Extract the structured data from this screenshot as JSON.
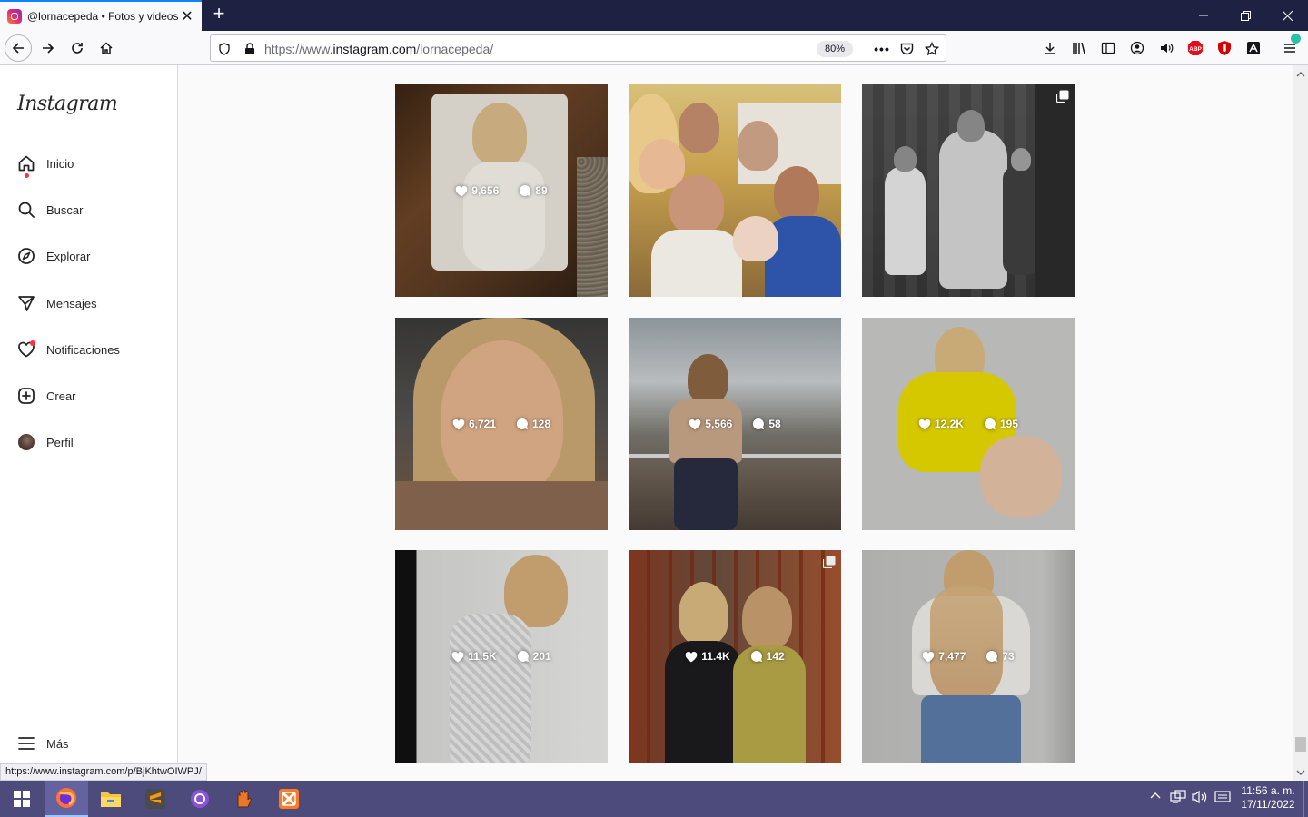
{
  "browser": {
    "tab_title": "@lornacepeda • Fotos y videos",
    "url_prefix": "https://www.",
    "url_domain": "instagram.com",
    "url_path": "/lornacepeda/",
    "zoom": "80%",
    "status_url": "https://www.instagram.com/p/BjKhtwOIWPJ/"
  },
  "sidebar": {
    "logo": "Instagram",
    "items": [
      {
        "label": "Inicio",
        "icon": "home-icon"
      },
      {
        "label": "Buscar",
        "icon": "search-icon"
      },
      {
        "label": "Explorar",
        "icon": "compass-icon"
      },
      {
        "label": "Mensajes",
        "icon": "send-icon"
      },
      {
        "label": "Notificaciones",
        "icon": "heart-icon"
      },
      {
        "label": "Crear",
        "icon": "plus-square-icon"
      },
      {
        "label": "Perfil",
        "icon": "avatar"
      }
    ],
    "more": "Más"
  },
  "posts": [
    {
      "likes": "9,656",
      "comments": "89",
      "multi": false
    },
    {
      "likes": "",
      "comments": "",
      "multi": false
    },
    {
      "likes": "",
      "comments": "",
      "multi": true
    },
    {
      "likes": "6,721",
      "comments": "128",
      "multi": false
    },
    {
      "likes": "5,566",
      "comments": "58",
      "multi": false
    },
    {
      "likes": "12.2K",
      "comments": "195",
      "multi": false
    },
    {
      "likes": "11.5K",
      "comments": "201",
      "multi": false
    },
    {
      "likes": "11.4K",
      "comments": "142",
      "multi": true
    },
    {
      "likes": "7,477",
      "comments": "73",
      "multi": false
    }
  ],
  "taskbar": {
    "time": "11:56 a. m.",
    "date": "17/11/2022"
  },
  "colors": {
    "accent": "#0a84ff",
    "notification_dot": "#ff3040",
    "taskbar": "#4c4b7c"
  }
}
